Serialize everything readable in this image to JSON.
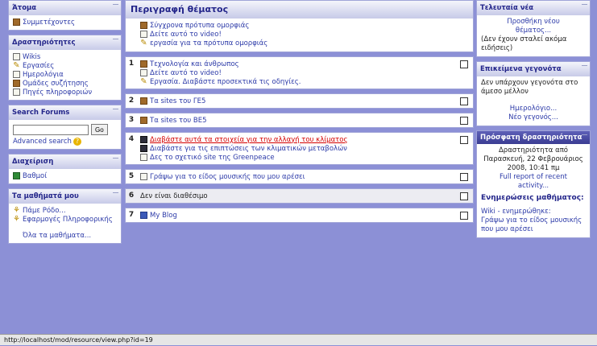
{
  "left": {
    "people": {
      "title": "Άτομα",
      "items": [
        {
          "label": "Συμμετέχοντες",
          "icon": "participants-icon"
        }
      ]
    },
    "activities": {
      "title": "Δραστηριότητες",
      "items": [
        {
          "label": "Wikis",
          "icon": "wiki-icon"
        },
        {
          "label": "Εργασίες",
          "icon": "assignment-icon"
        },
        {
          "label": "Ημερολόγια",
          "icon": "journal-icon"
        },
        {
          "label": "Ομάδες συζήτησης",
          "icon": "forum-icon"
        },
        {
          "label": "Πηγές πληροφοριών",
          "icon": "resource-icon"
        }
      ]
    },
    "search": {
      "title": "Search Forums",
      "go": "Go",
      "advanced": "Advanced search",
      "input_value": ""
    },
    "admin": {
      "title": "Διαχείριση",
      "items": [
        {
          "label": "Βαθμοί",
          "icon": "grades-icon"
        }
      ]
    },
    "courses": {
      "title": "Τα μαθήματά μου",
      "items": [
        {
          "label": "Πάμε Ρόδο..."
        },
        {
          "label": "Εφαρμογές Πληροφορικής"
        },
        {
          "label": "Όλα τα μαθήματα..."
        }
      ]
    }
  },
  "center": {
    "header": "Περιγραφή θέματος",
    "topic0": [
      {
        "label": "Σύγχρονα πρότυπα ομορφιάς",
        "icon": "forum-icon"
      },
      {
        "label": "Δείτε αυτό το video!",
        "icon": "resource-page-icon"
      },
      {
        "label": "εργασία για τα πρότυπα ομορφιάς",
        "icon": "assignment-icon"
      }
    ],
    "sections": [
      {
        "num": "1",
        "items": [
          {
            "label": "Τεχνολογία και άνθρωπος",
            "icon": "forum-icon"
          },
          {
            "label": "Δείτε αυτό το video!",
            "icon": "resource-page-icon"
          },
          {
            "label": "Εργασία. Διαβάστε προσεκτικά τις οδηγίες.",
            "icon": "assignment-icon"
          }
        ]
      },
      {
        "num": "2",
        "items": [
          {
            "label": "Τα sites του ΓΕ5",
            "icon": "forum-icon"
          }
        ]
      },
      {
        "num": "3",
        "items": [
          {
            "label": "Τα sites του ΒΕ5",
            "icon": "forum-icon"
          }
        ]
      },
      {
        "num": "4",
        "items": [
          {
            "label": "Διαβάστε αυτά τα στοιχεία για την αλλαγή του κλίματος",
            "icon": "resource-dark-icon",
            "highlight": true
          },
          {
            "label": "Διαβάστε για τις επιπτώσεις των κλιματικών μεταβολών",
            "icon": "resource-dark-icon"
          },
          {
            "label": "Δες το σχετικό site της Greenpeace",
            "icon": "link-icon"
          }
        ]
      },
      {
        "num": "5",
        "items": [
          {
            "label": "Γράψω για το είδος μουσικής που μου αρέσει",
            "icon": "journal-icon"
          }
        ]
      },
      {
        "num": "6",
        "unavailable": "Δεν είναι διαθέσιμο"
      },
      {
        "num": "7",
        "items": [
          {
            "label": "My Blog",
            "icon": "blog-icon"
          }
        ]
      }
    ]
  },
  "right": {
    "news": {
      "title": "Τελευταία νέα",
      "add": "Προσθήκη νέου θέματος...",
      "none": "(Δεν έχουν σταλεί ακόμα ειδήσεις)"
    },
    "events": {
      "title": "Επικείμενα γεγονότα",
      "none": "Δεν υπάρχουν γεγονότα στο άμεσο μέλλον",
      "calendar": "Ημερολόγιο...",
      "new_event": "Νέο γεγονός..."
    },
    "recent": {
      "title": "Πρόσφατη δραστηριότητα",
      "since": "Δραστηριότητα από Παρασκευή, 22 Φεβρουάριος 2008, 10:41 πμ",
      "full_report": "Full report of recent activity...",
      "updates_title": "Ενημερώσεις μαθήματος:",
      "update1": "Wiki - ενημερώθηκε:",
      "update2": "Γράψω για το είδος μουσικής που μου αρέσει"
    }
  },
  "status_bar": "http://localhost/mod/resource/view.php?id=19"
}
